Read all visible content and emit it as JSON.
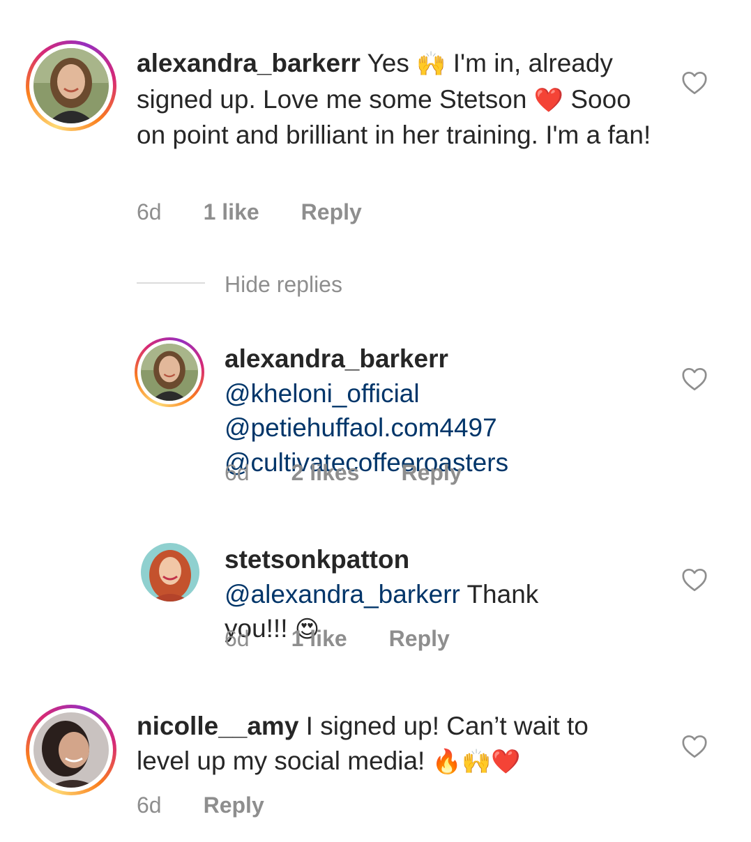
{
  "comments": [
    {
      "username": "alexandra_barkerr",
      "text_parts": [
        "Yes ",
        "🙌",
        " I'm in, already signed up. Love me some Stetson ",
        "❤️",
        " Sooo on point and brilliant in her training. I'm a fan!"
      ],
      "time": "6d",
      "likes": "1 like",
      "reply": "Reply"
    }
  ],
  "hide_replies": "Hide replies",
  "replies": [
    {
      "username": "alexandra_barkerr",
      "mentions": [
        "@kheloni_official",
        "@petiehuffaol.com4497",
        "@cultivatecoffeeroasters"
      ],
      "time": "6d",
      "likes": "2 likes",
      "reply": "Reply"
    },
    {
      "username": "stetsonkpatton",
      "mention": "@alexandra_barkerr",
      "text": " Thank you!!! ",
      "emoji": "😍",
      "time": "6d",
      "likes": "1 like",
      "reply": "Reply"
    }
  ],
  "comment2": {
    "username": "nicolle__amy",
    "text": " I signed up! Can’t wait to level up my social media! ",
    "emojis": "🔥🙌❤️",
    "time": "6d",
    "reply": "Reply"
  },
  "icons": {
    "like": "heart-outline-icon"
  },
  "colors": {
    "text": "#262626",
    "secondary": "#8e8e8e",
    "mention": "#003569",
    "story_ring": [
      "#feda75",
      "#fa7e1e",
      "#d62976",
      "#962fbf"
    ]
  }
}
